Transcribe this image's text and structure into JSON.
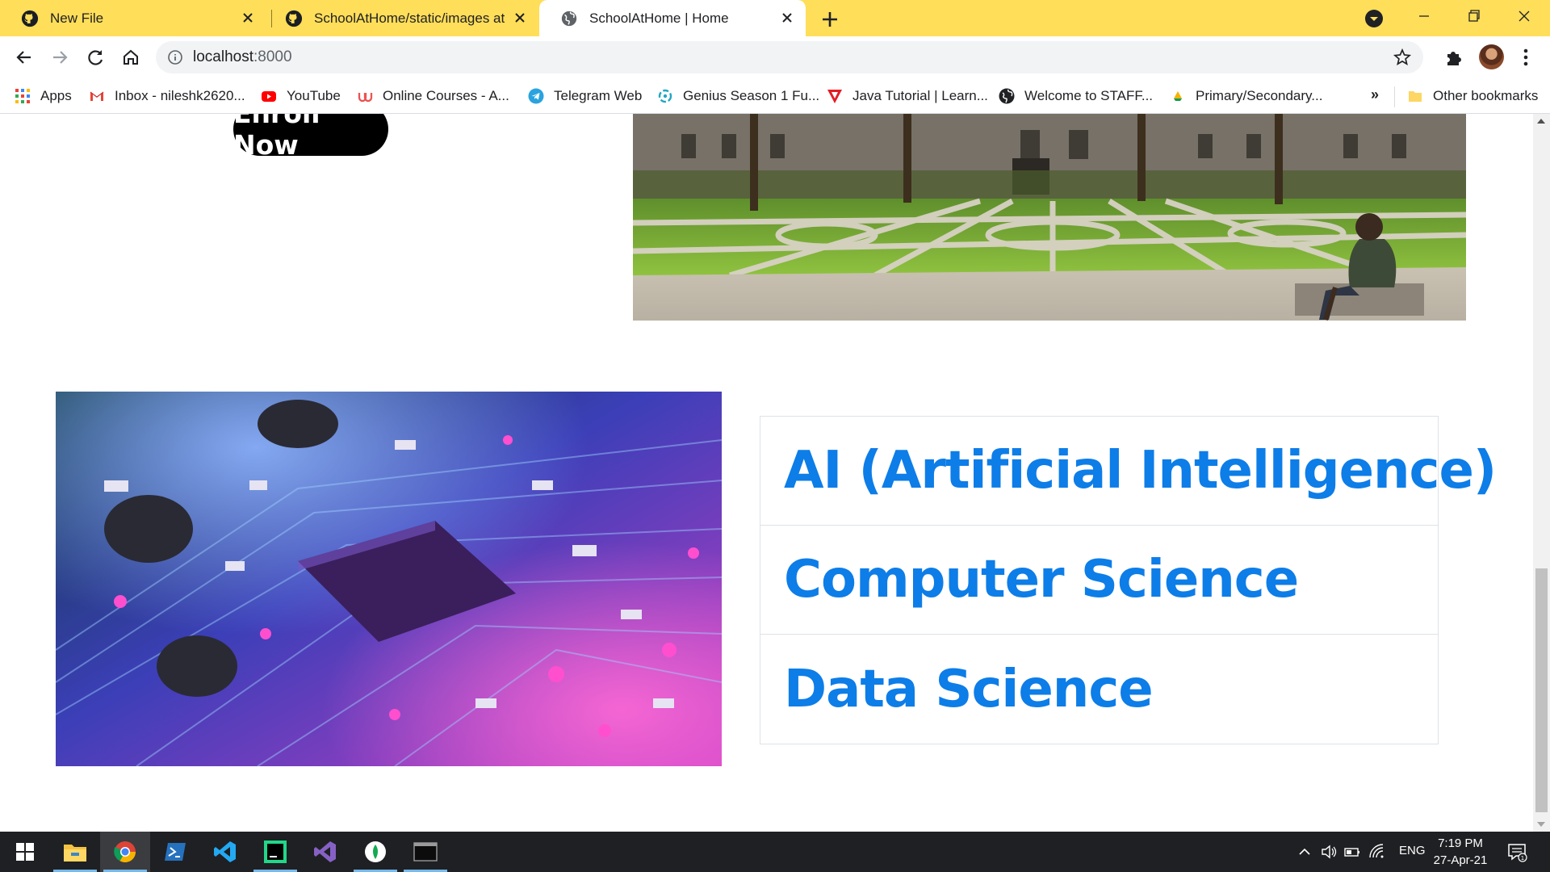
{
  "browser": {
    "tabs": [
      {
        "title": "New File",
        "icon": "github-icon",
        "active": false
      },
      {
        "title": "SchoolAtHome/static/images at r",
        "icon": "github-icon",
        "active": false
      },
      {
        "title": "SchoolAtHome | Home",
        "icon": "globe-icon",
        "active": true
      }
    ],
    "address": {
      "host": "localhost",
      "port": ":8000"
    },
    "bookmarks": [
      {
        "label": "Apps",
        "icon": "apps-grid-icon"
      },
      {
        "label": "Inbox - nileshk2620...",
        "icon": "gmail-icon"
      },
      {
        "label": "YouTube",
        "icon": "youtube-icon"
      },
      {
        "label": "Online Courses - A...",
        "icon": "udemy-icon"
      },
      {
        "label": "Telegram Web",
        "icon": "telegram-icon"
      },
      {
        "label": "Genius Season 1 Fu...",
        "icon": "genius-icon"
      },
      {
        "label": "Java Tutorial | Learn...",
        "icon": "tutorial-icon"
      },
      {
        "label": "Welcome to STAFF...",
        "icon": "globe-icon"
      },
      {
        "label": "Primary/Secondary...",
        "icon": "drive-icon"
      }
    ],
    "bookmarks_overflow": "»",
    "other_bookmarks": "Other bookmarks"
  },
  "page": {
    "enroll_button": "Enroll Now",
    "courses": [
      "AI (Artificial Intelligence)",
      "Computer Science",
      "Data Science"
    ],
    "accent_color": "#0d7de8"
  },
  "taskbar": {
    "apps": [
      "start-icon",
      "file-explorer-icon",
      "chrome-icon",
      "powershell-icon",
      "vscode-icon",
      "pycharm-icon",
      "visual-studio-icon",
      "mongodb-compass-icon",
      "terminal-icon"
    ],
    "language": "ENG",
    "time": "7:19 PM",
    "date": "27-Apr-21",
    "notification_count": "1"
  }
}
